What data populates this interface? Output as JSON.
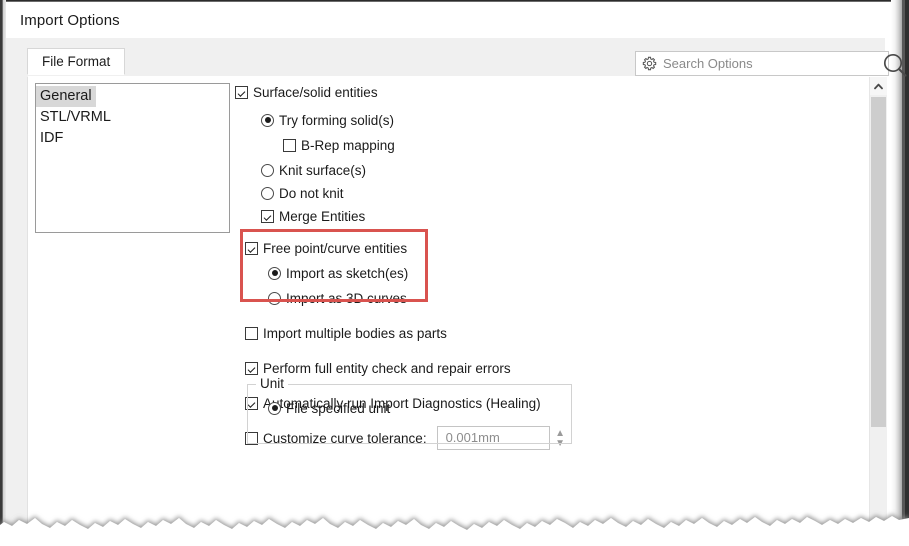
{
  "window": {
    "title": "Import Options"
  },
  "tabs": [
    {
      "label": "File Format",
      "active": true
    }
  ],
  "search": {
    "placeholder": "Search Options",
    "value": "",
    "gear_icon": "gear-icon",
    "search_icon": "magnifier-icon"
  },
  "format_list": {
    "items": [
      {
        "label": "General",
        "selected": true
      },
      {
        "label": "STL/VRML",
        "selected": false
      },
      {
        "label": "IDF",
        "selected": false
      }
    ]
  },
  "options": {
    "surface_solid": {
      "label": "Surface/solid entities",
      "checked": true
    },
    "try_forming_solid": {
      "label": "Try forming solid(s)",
      "checked": true
    },
    "brep_mapping": {
      "label": "B-Rep mapping",
      "checked": false
    },
    "knit_surface": {
      "label": "Knit surface(s)",
      "checked": false
    },
    "do_not_knit": {
      "label": "Do not knit",
      "checked": false
    },
    "merge_entities": {
      "label": "Merge Entities",
      "checked": true
    },
    "free_point_curve": {
      "label": "Free point/curve entities",
      "checked": true
    },
    "import_as_sketches": {
      "label": "Import as sketch(es)",
      "checked": true
    },
    "import_as_3d_curves": {
      "label": "Import as 3D curves",
      "checked": false
    },
    "import_multiple_bodies": {
      "label": "Import multiple bodies as parts",
      "checked": false
    },
    "perform_full_entity_check": {
      "label": "Perform full entity check and repair errors",
      "checked": true
    },
    "auto_import_diagnostics": {
      "label": "Automatically run Import Diagnostics (Healing)",
      "checked": true
    },
    "customize_curve_tolerance": {
      "label": "Customize curve tolerance:",
      "checked": false
    },
    "curve_tolerance_value": "0.001mm"
  },
  "unit_group": {
    "title": "Unit",
    "file_specified_unit": {
      "label": "File specified unit",
      "checked": true
    }
  },
  "highlight": {
    "color": "#d9534f",
    "note": "red annotation box around free point/curve entities options"
  },
  "scrollbar": {
    "up_arrow": "chevron-up-icon"
  }
}
